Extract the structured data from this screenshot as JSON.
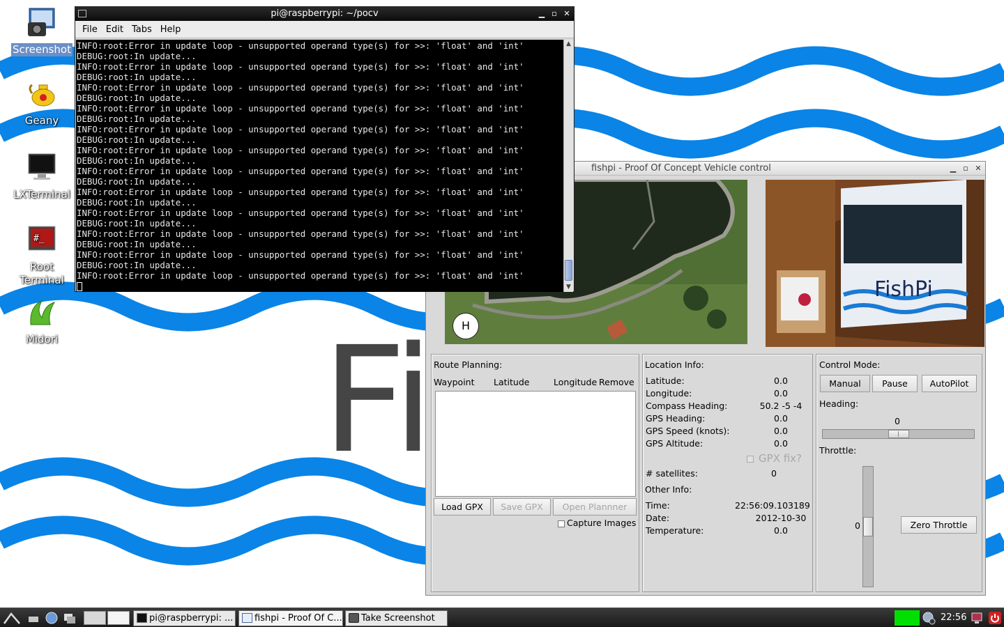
{
  "desktop": {
    "wallpaper_text": "Fi",
    "icons": [
      {
        "label": "Screenshot",
        "icon": "screenshot-icon"
      },
      {
        "label": "Geany",
        "icon": "geany-icon"
      },
      {
        "label": "LXTerminal",
        "icon": "lxterminal-icon"
      },
      {
        "label": "Root Terminal",
        "icon": "root-terminal-icon"
      },
      {
        "label": "Midori",
        "icon": "midori-icon"
      }
    ]
  },
  "terminal": {
    "title": "pi@raspberrypi: ~/pocv",
    "menu": [
      "File",
      "Edit",
      "Tabs",
      "Help"
    ],
    "error_line": "INFO:root:Error in update loop - unsupported operand type(s) for >>: 'float' and 'int'",
    "debug_line": "DEBUG:root:In update...",
    "pair_count": 12
  },
  "fishpi": {
    "title": "fishpi - Proof Of Concept Vehicle control",
    "map_marker": "H",
    "camera_overlay_text": "FishPi",
    "route": {
      "title": "Route Planning:",
      "columns": [
        "Waypoint",
        "Latitude",
        "Longitude",
        "Remove"
      ],
      "load_gpx": "Load GPX",
      "save_gpx": "Save GPX",
      "open_planner": "Open Plannner",
      "capture_images": "Capture Images"
    },
    "location": {
      "title": "Location Info:",
      "latitude_label": "Latitude:",
      "latitude": "0.0",
      "longitude_label": "Longitude:",
      "longitude": "0.0",
      "compass_label": "Compass Heading:",
      "compass": "50.2 -5 -4",
      "gps_heading_label": "GPS Heading:",
      "gps_heading": "0.0",
      "gps_speed_label": "GPS Speed (knots):",
      "gps_speed": "0.0",
      "gps_altitude_label": "GPS Altitude:",
      "gps_altitude": "0.0",
      "gpx_fix_label": "GPX fix?",
      "satellites_label": "# satellites:",
      "satellites": "0",
      "other_title": "Other Info:",
      "time_label": "Time:",
      "time": "22:56:09.103189",
      "date_label": "Date:",
      "date": "2012-10-30",
      "temperature_label": "Temperature:",
      "temperature": "0.0"
    },
    "control": {
      "title": "Control Mode:",
      "manual": "Manual",
      "pause": "Pause",
      "autopilot": "AutoPilot",
      "heading_label": "Heading:",
      "heading_value": "0",
      "heading_fraction": 0.5,
      "throttle_label": "Throttle:",
      "throttle_value": "0",
      "throttle_fraction": 0.5,
      "zero_throttle": "Zero Throttle"
    }
  },
  "taskbar": {
    "tasks": [
      {
        "label": "pi@raspberrypi: ...",
        "icon": "terminal-icon"
      },
      {
        "label": "fishpi - Proof Of C...",
        "icon": "window-icon"
      },
      {
        "label": "Take Screenshot",
        "icon": "camera-icon"
      }
    ],
    "clock": "22:56",
    "colors": {
      "cpu_monitor": "#00e000"
    }
  }
}
